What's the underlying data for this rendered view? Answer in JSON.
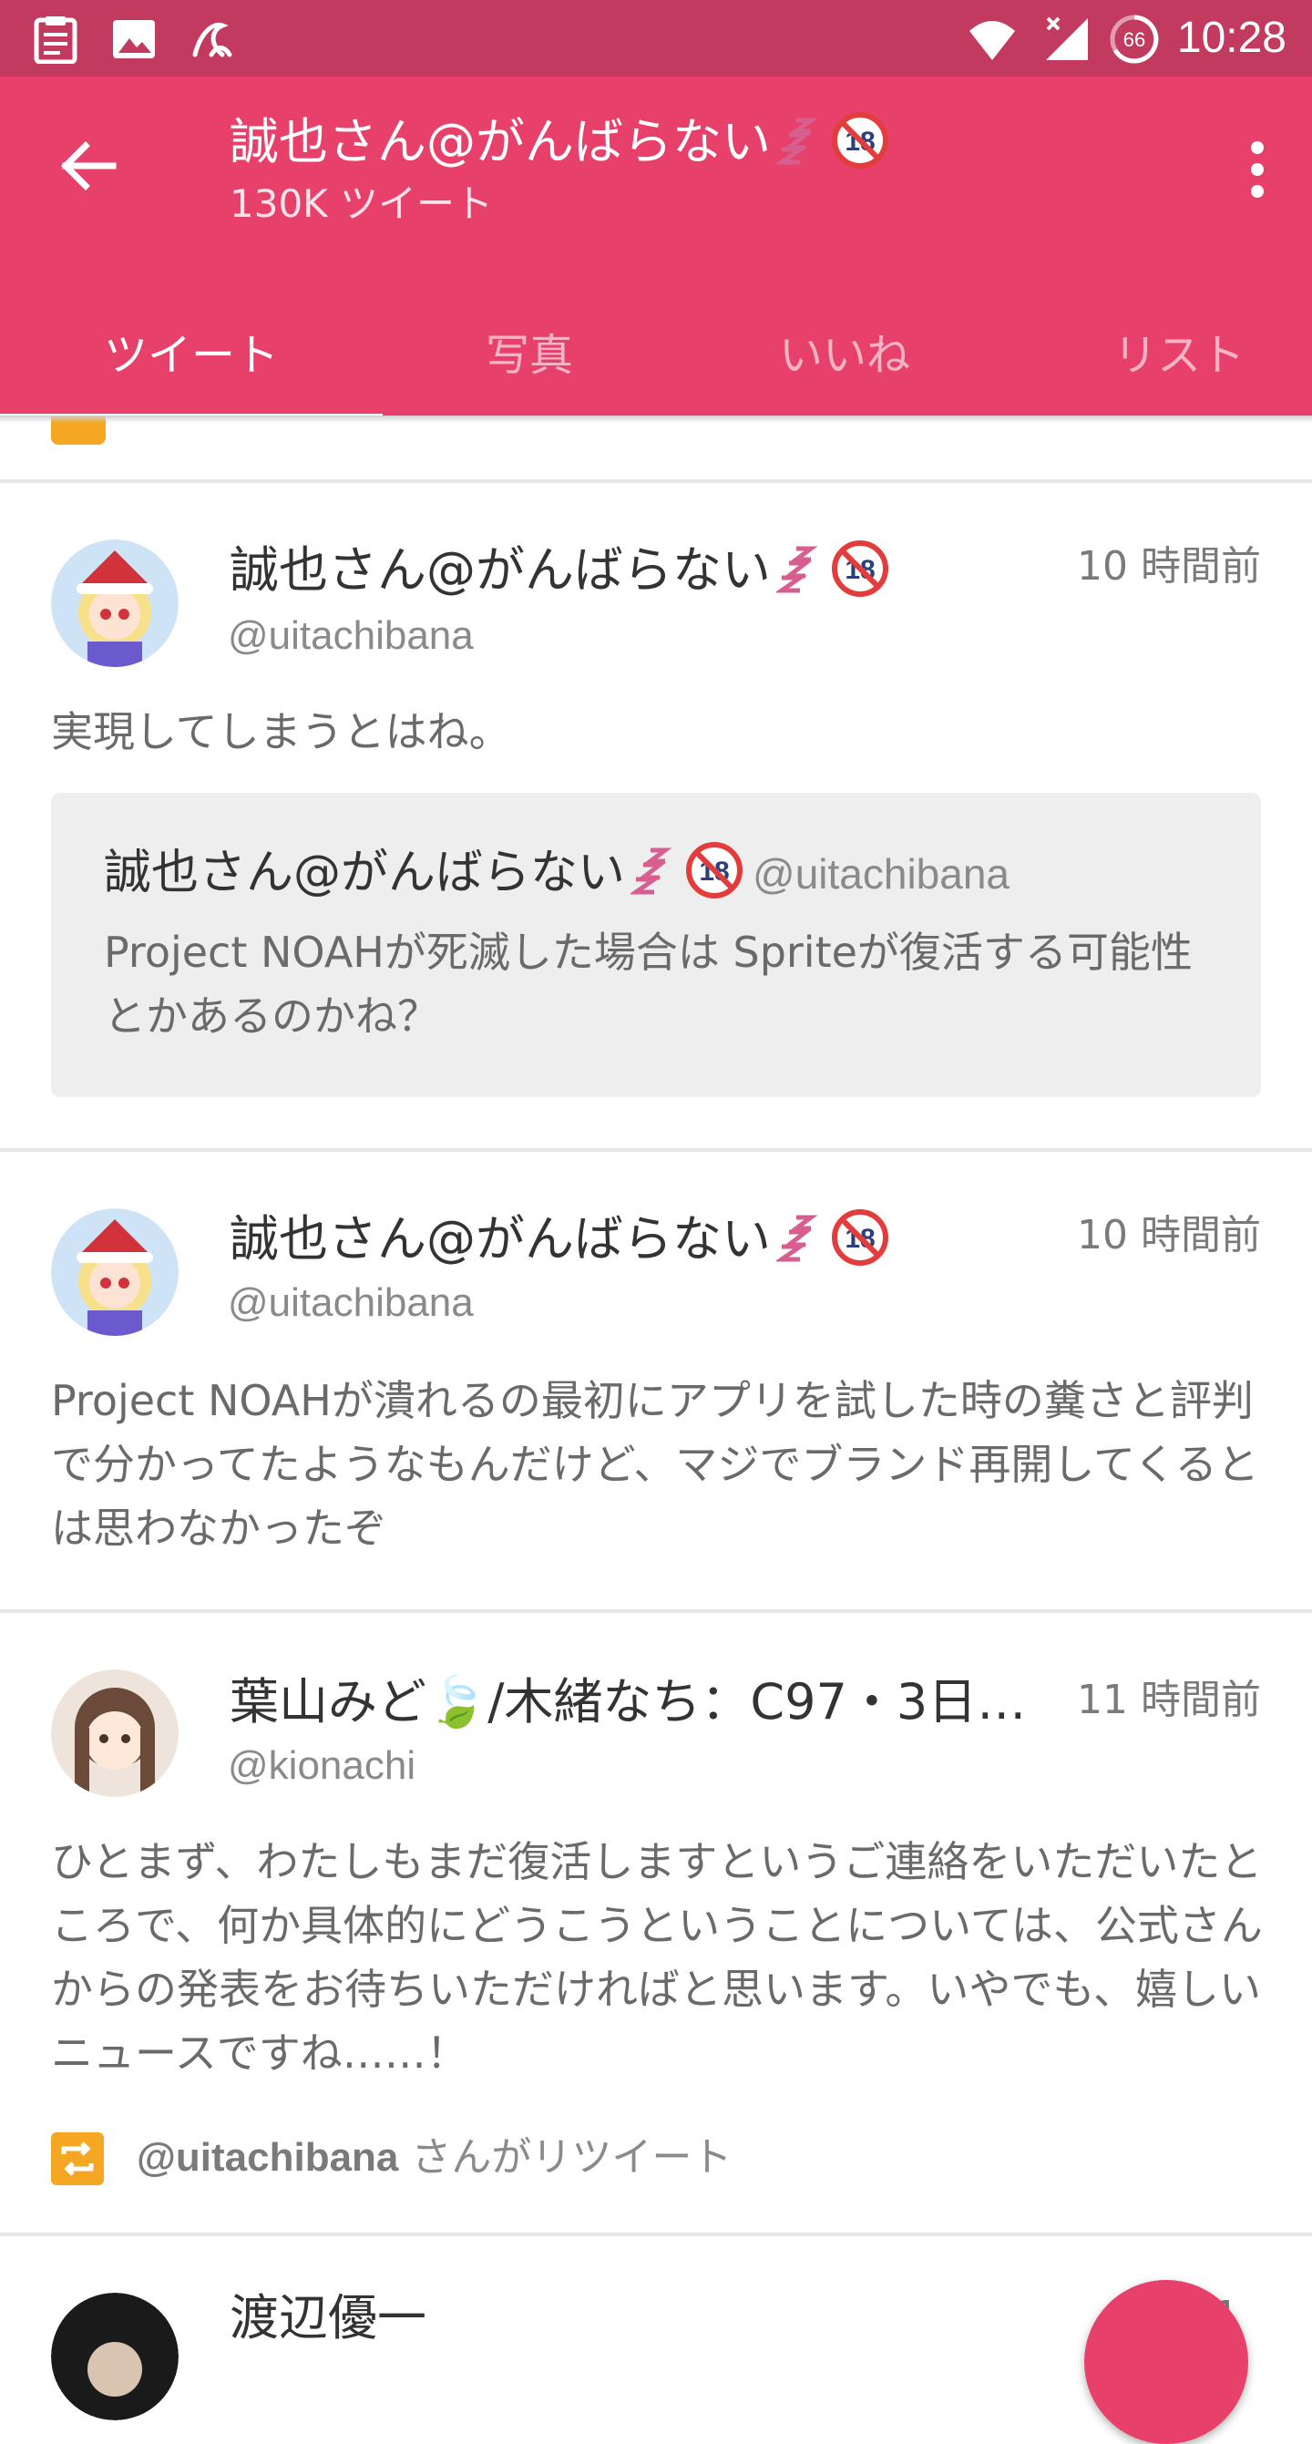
{
  "status_bar": {
    "time": "10:28",
    "battery_level": "66",
    "left_icons": [
      "clipboard-icon",
      "image-icon",
      "app-notification-icon"
    ],
    "right_icons": [
      "wifi-icon",
      "signal-icon",
      "battery-icon"
    ]
  },
  "header": {
    "title": "誠也さん@がんばらない",
    "title_emoji": [
      "zzz-emoji",
      "no-under-18-emoji"
    ],
    "subtitle": "130K ツイート",
    "colors": {
      "primary": "#e7416b",
      "status_bar": "#c23a5d"
    }
  },
  "tabs": [
    {
      "label": "ツイート",
      "active": true
    },
    {
      "label": "写真",
      "active": false
    },
    {
      "label": "いいね",
      "active": false
    },
    {
      "label": "リスト",
      "active": false
    }
  ],
  "tweets": [
    {
      "name": "誠也さん@がんばらない",
      "handle": "@uitachibana",
      "time": "10 時間前",
      "text": "実現してしまうとはね。",
      "quote": {
        "name": "誠也さん@がんばらない",
        "handle": "@uitachibana",
        "text": "Project NOAHが死滅した場合は Spriteが復活する可能性とかあるのかね？"
      }
    },
    {
      "name": "誠也さん@がんばらない",
      "handle": "@uitachibana",
      "time": "10 時間前",
      "text": "Project NOAHが潰れるの最初にアプリを試した時の糞さと評判で分かってたようなもんだけど、マジでブランド再開してくるとは思わなかったぞ"
    },
    {
      "name": "葉山みど🍃/木緒なち：C97・3日…",
      "handle": "@kionachi",
      "time": "11 時間前",
      "text": "ひとまず、わたしもまだ復活しますというご連絡をいただいたところで、何か具体的にどうこうということについては、公式さんからの発表をお待ちいただければと思います。いやでも、嬉しいニュースですね……！",
      "retweet": {
        "handle": "@uitachibana",
        "suffix": " さんがリツイート"
      }
    },
    {
      "name": "渡辺優一",
      "time": "1"
    }
  ]
}
